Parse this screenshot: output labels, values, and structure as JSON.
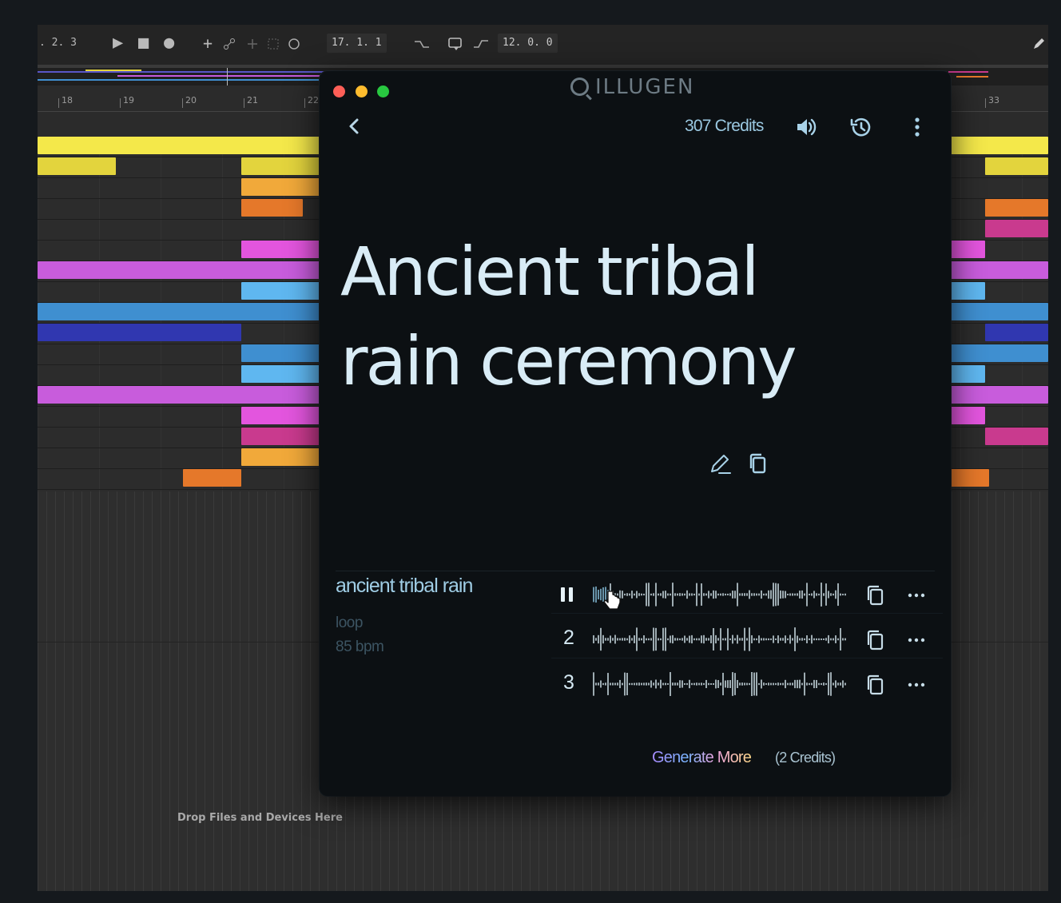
{
  "daw": {
    "transport": {
      "position_left": ". 2. 3",
      "play_symbol": "▶",
      "stop_symbol": "■",
      "record_symbol": "●",
      "add_symbol": "+",
      "loop_start": "17. 1. 1",
      "loop_length": "12. 0. 0"
    },
    "ruler": [
      "18",
      "19",
      "20",
      "21",
      "22",
      "33"
    ],
    "drop_hint": "Drop Files and Devices Here",
    "clip_colors": [
      "#f4e84a",
      "#e3d43d",
      "#f1a93a",
      "#e5782a",
      "#e355de",
      "#c85cdc",
      "#5fb7f0",
      "#3f8fd0",
      "#3037b0",
      "#c93a8e"
    ]
  },
  "app": {
    "logo": "ILLUGEN",
    "credits": "307 Credits",
    "header_icons": [
      "back-icon",
      "speaker-icon",
      "history-icon",
      "more-vertical-icon"
    ],
    "prompt_title": "Ancient tribal rain ceremony",
    "track": {
      "name": "ancient tribal rain",
      "type": "loop",
      "bpm": "85 bpm"
    },
    "variations": [
      {
        "label": "",
        "state": "playing",
        "icon": "pause-icon"
      },
      {
        "label": "2",
        "state": "idle"
      },
      {
        "label": "3",
        "state": "idle"
      }
    ],
    "generate_more": "Generate More",
    "generate_cost": "(2 Credits)",
    "traffic_lights": {
      "close": "#fe5f57",
      "minimize": "#febc2e",
      "zoom": "#28c840"
    }
  }
}
